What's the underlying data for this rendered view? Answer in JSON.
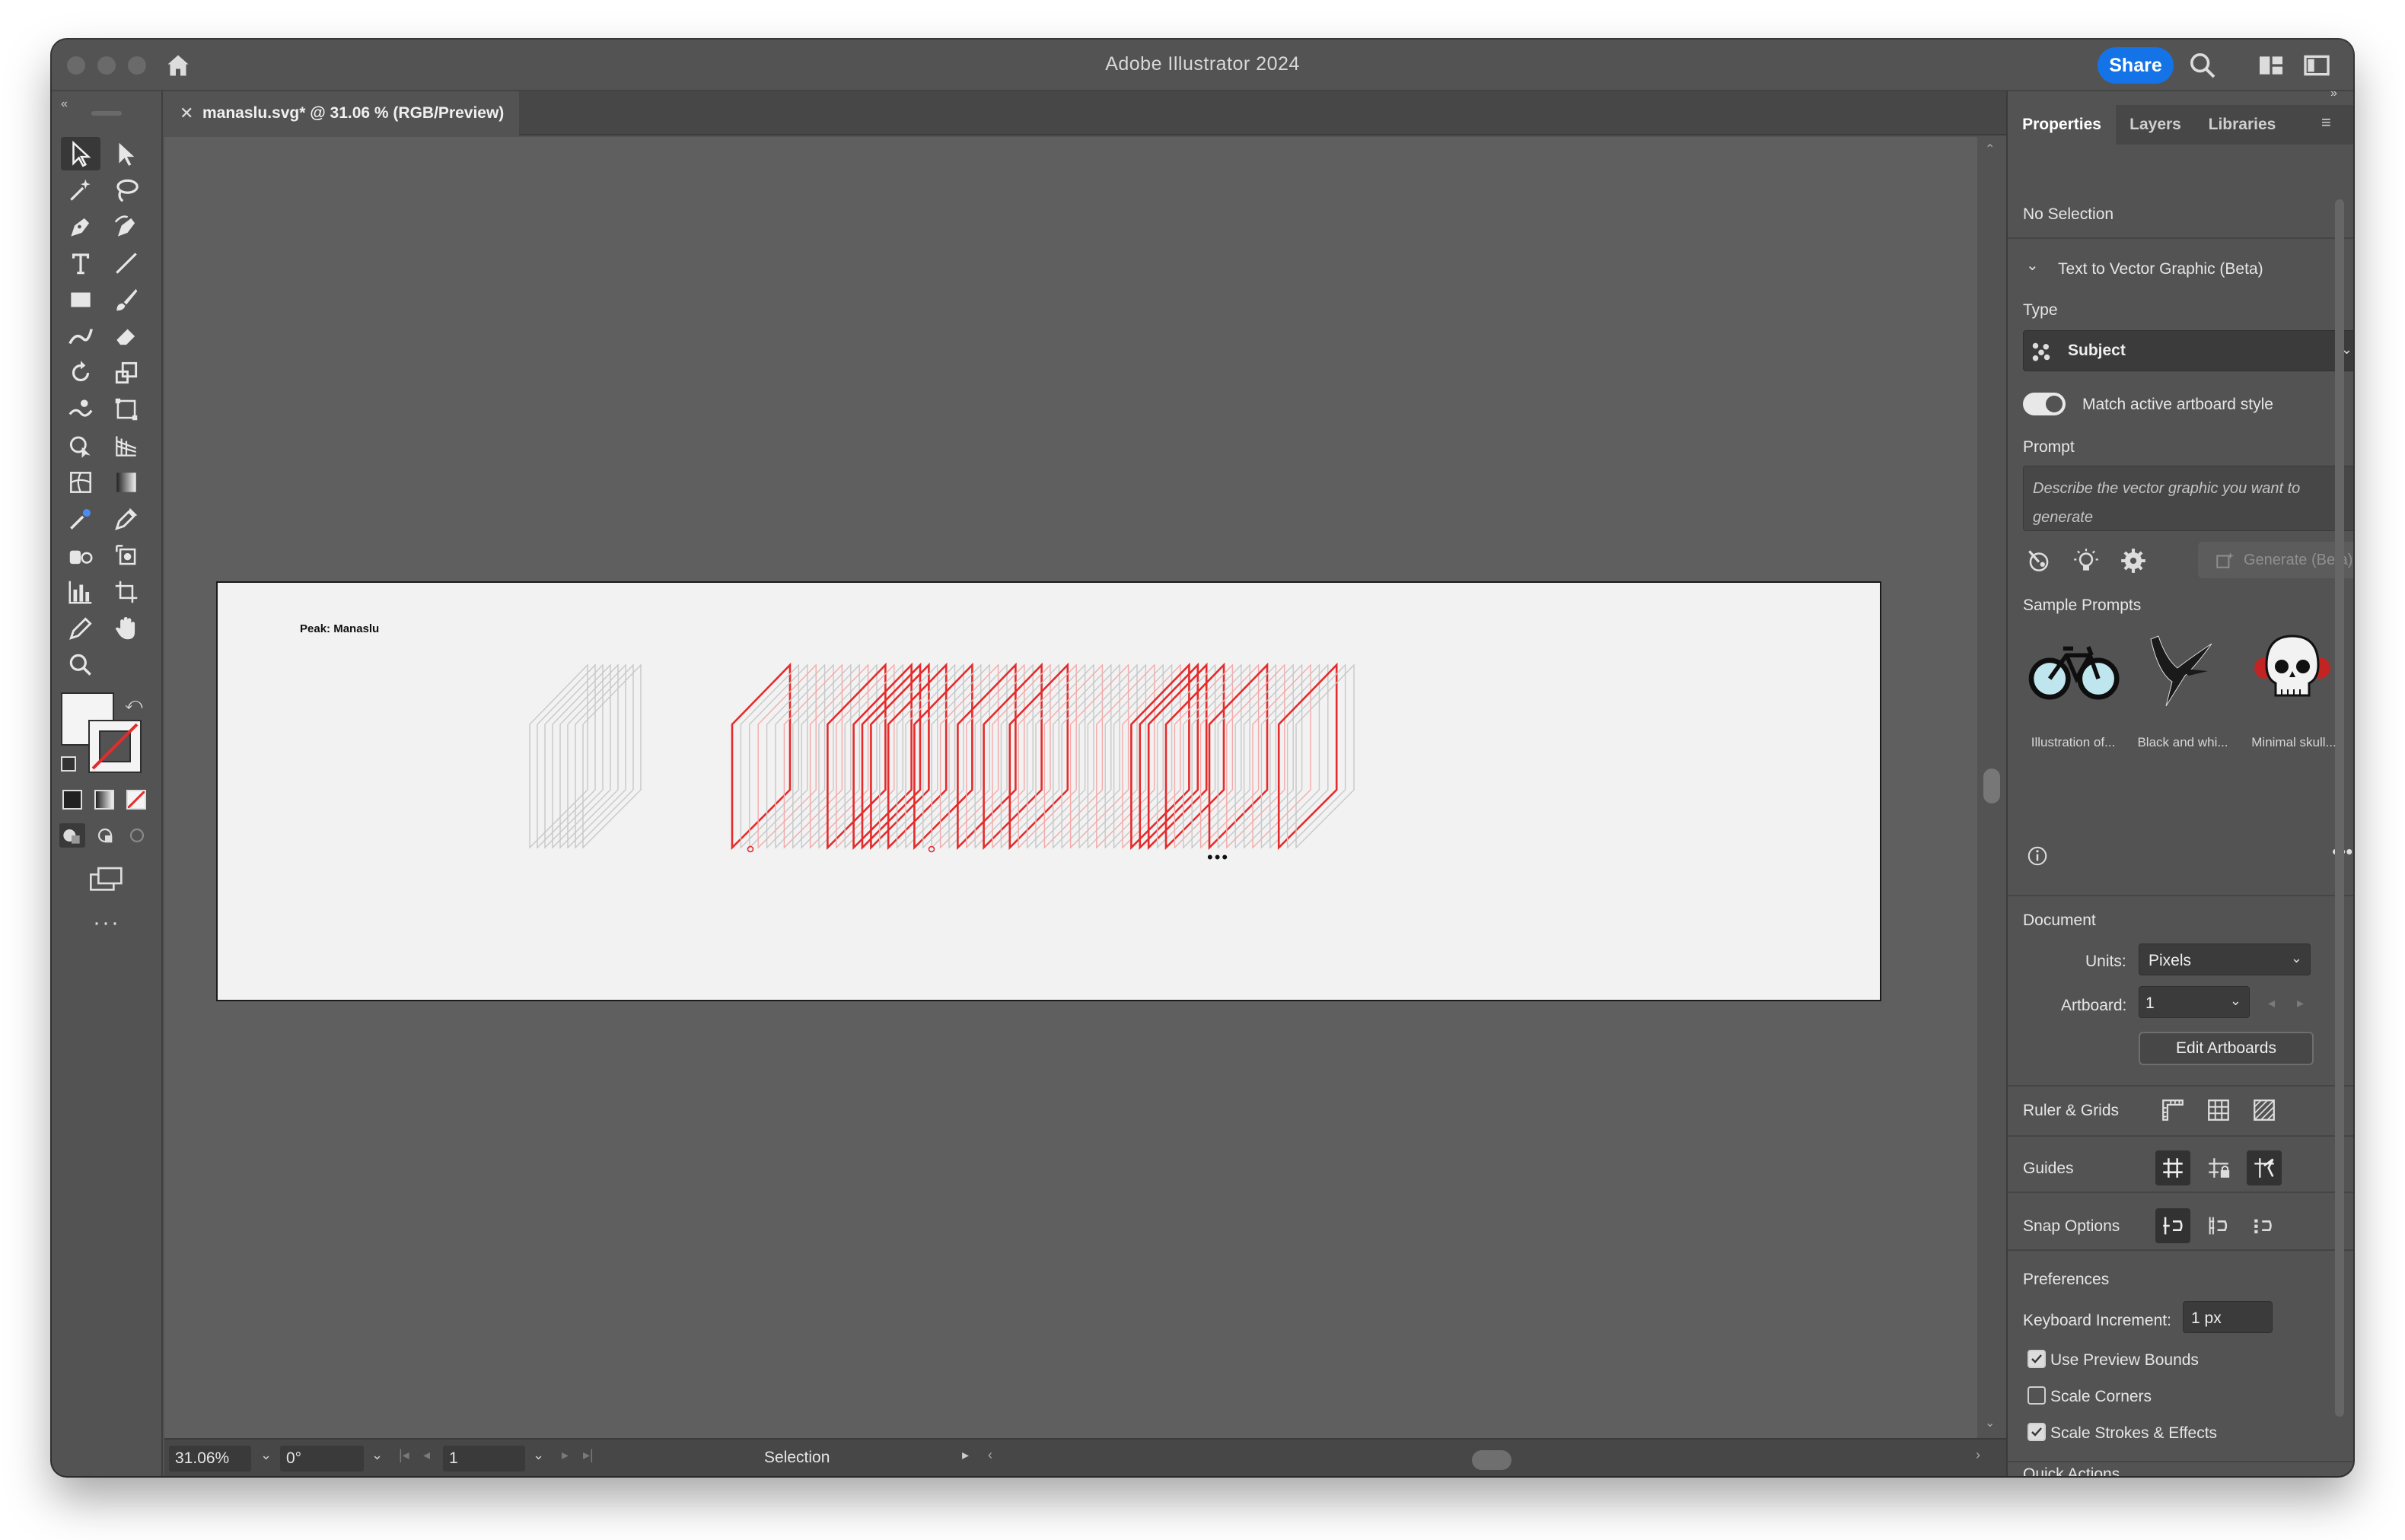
{
  "app": {
    "window_title": "Adobe Illustrator 2024",
    "share_label": "Share"
  },
  "document": {
    "tab_title": "manaslu.svg* @ 31.06 % (RGB/Preview)",
    "artboard_text": "Peak: Manaslu",
    "accent_color": "#e52b2b"
  },
  "status_bar": {
    "zoom": "31.06%",
    "rotation": "0°",
    "artboard_number": "1",
    "tool_name": "Selection"
  },
  "panel": {
    "tabs": [
      "Properties",
      "Layers",
      "Libraries"
    ],
    "selection_state": "No Selection",
    "section_title": "Text to Vector Graphic (Beta)",
    "type_label": "Type",
    "type_value": "Subject",
    "match_style_label": "Match active artboard style",
    "match_style_on": true,
    "prompt_label": "Prompt",
    "prompt_placeholder": "Describe the vector graphic you want to generate",
    "generate_label": "Generate (Beta)",
    "sample_prompts_label": "Sample Prompts",
    "samples": [
      {
        "caption": "Illustration of...",
        "icon": "bicycle-icon"
      },
      {
        "caption": "Black and whi...",
        "icon": "bird-icon"
      },
      {
        "caption": "Minimal skull...",
        "icon": "skull-icon"
      }
    ],
    "document_label": "Document",
    "units_label": "Units:",
    "units_value": "Pixels",
    "artboard_label": "Artboard:",
    "artboard_value": "1",
    "edit_artboards_label": "Edit Artboards",
    "ruler_grids_label": "Ruler & Grids",
    "guides_label": "Guides",
    "snap_options_label": "Snap Options",
    "preferences_label": "Preferences",
    "keyboard_increment_label": "Keyboard Increment:",
    "keyboard_increment_value": "1 px",
    "use_preview_bounds_label": "Use Preview Bounds",
    "use_preview_bounds": true,
    "scale_corners_label": "Scale Corners",
    "scale_corners": false,
    "scale_strokes_label": "Scale Strokes & Effects",
    "scale_strokes": true,
    "quick_actions_label": "Quick Actions"
  }
}
